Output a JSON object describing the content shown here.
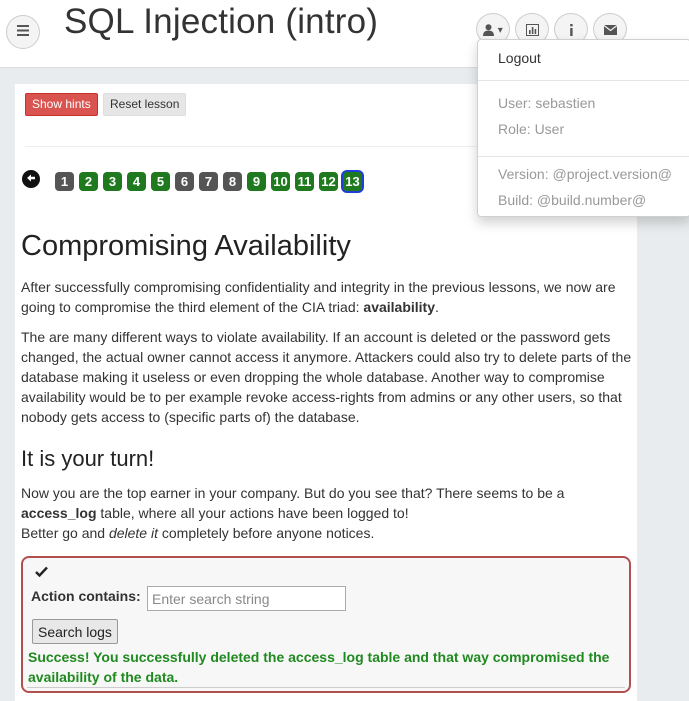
{
  "header": {
    "title": "SQL Injection (intro)",
    "menu_icon": "hamburger-icon",
    "buttons": [
      {
        "icon": "user-icon",
        "caret": "▾"
      },
      {
        "icon": "chart-icon"
      },
      {
        "icon": "info-icon"
      },
      {
        "icon": "envelope-icon"
      }
    ]
  },
  "user_menu": {
    "logout": "Logout",
    "user": "User: sebastien",
    "role": "Role: User",
    "version": "Version: @project.version@",
    "build": "Build: @build.number@"
  },
  "lesson": {
    "show_hints": "Show hints",
    "reset_lesson": "Reset lesson",
    "back_icon": "arrow-left-icon",
    "pages": [
      {
        "label": "1",
        "state": "grey"
      },
      {
        "label": "2",
        "state": "green"
      },
      {
        "label": "3",
        "state": "green"
      },
      {
        "label": "4",
        "state": "green"
      },
      {
        "label": "5",
        "state": "green"
      },
      {
        "label": "6",
        "state": "grey"
      },
      {
        "label": "7",
        "state": "grey"
      },
      {
        "label": "8",
        "state": "grey"
      },
      {
        "label": "9",
        "state": "green"
      },
      {
        "label": "10",
        "state": "green"
      },
      {
        "label": "11",
        "state": "green"
      },
      {
        "label": "12",
        "state": "green"
      },
      {
        "label": "13",
        "state": "current"
      }
    ],
    "title": "Compromising Availability",
    "p1_text": "After successfully compromising confidentiality and integrity in the previous lessons, we now are going to compromise the third element of the CIA triad: ",
    "p1_bold": "availability",
    "p1_end": ".",
    "p2": "The are many different ways to violate availability. If an account is deleted or the password gets changed, the actual owner cannot access it anymore. Attackers could also try to delete parts of the database making it useless or even dropping the whole database. Another way to compromise availability would be to per example revoke access-rights from admins or any other users, so that nobody gets access to (specific parts of) the database.",
    "turn_title": "It is your turn!",
    "p3_a": "Now you are the top earner in your company. But do you see that? There seems to be a ",
    "p3_bold": "access_log",
    "p3_b": " table, where all your actions have been logged to!",
    "p3_c": "Better go and ",
    "p3_italic": "delete it",
    "p3_d": " completely before anyone notices."
  },
  "attack": {
    "check_icon": "checkmark-icon",
    "label": "Action contains:",
    "placeholder": "Enter search string",
    "value": "",
    "button": "Search logs",
    "success": "Success! You successfully deleted the access_log table and that way compromised the availability of the data."
  },
  "colors": {
    "hints_button": "#d9534f",
    "page_green": "#1f7a1f",
    "page_grey": "#555555",
    "current_outline": "#1f3fd6",
    "success_text": "#1f8a1f",
    "attack_border": "#b05050"
  }
}
